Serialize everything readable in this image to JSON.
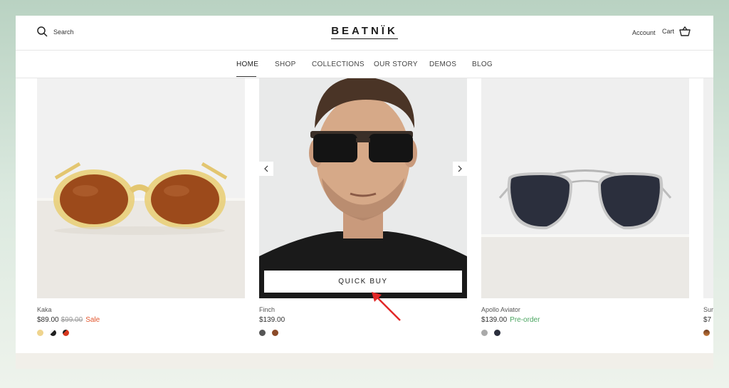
{
  "header": {
    "search_label": "Search",
    "logo_text": "BEATNÏK",
    "account_label": "Account",
    "cart_label": "Cart"
  },
  "nav": {
    "items": [
      {
        "label": "HOME",
        "active": true
      },
      {
        "label": "SHOP"
      },
      {
        "label": "COLLECTIONS"
      },
      {
        "label": "OUR STORY"
      },
      {
        "label": "DEMOS"
      },
      {
        "label": "BLOG"
      }
    ]
  },
  "products": [
    {
      "name": "Kaka",
      "price": "$89.00",
      "compare_price": "$99.00",
      "badge": "Sale",
      "swatches": [
        "#efd48e",
        "#1f1f1f",
        "#d6371d"
      ]
    },
    {
      "name": "Finch",
      "price": "$139.00",
      "swatches": [
        "#555555",
        "#8b4a28"
      ],
      "quick_buy_label": "QUICK BUY"
    },
    {
      "name": "Apollo Aviator",
      "price": "$139.00",
      "badge": "Pre-order",
      "swatches": [
        "#a9a9a9",
        "#2b2f3d"
      ]
    },
    {
      "name": "Sur",
      "price": "$7"
    }
  ],
  "colors": {
    "sale": "#e2562e",
    "preorder": "#4aa560",
    "annotation_arrow": "#e22727"
  },
  "icons": {
    "search": "search-icon",
    "cart": "basket-icon",
    "prev": "chevron-left-icon",
    "next": "chevron-right-icon"
  }
}
